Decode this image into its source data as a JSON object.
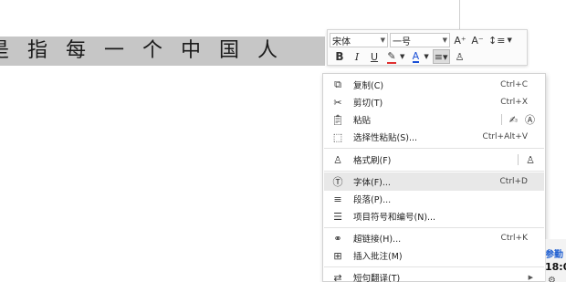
{
  "document": {
    "selected_text": "是指每一个中国人"
  },
  "mini_toolbar": {
    "font_name": "宋体",
    "font_size": "一号",
    "grow_font_icon": "A⁺",
    "shrink_font_icon": "A⁻",
    "bold": "B",
    "italic": "I",
    "underline": "U",
    "font_color_letter": "A"
  },
  "context_menu": {
    "items": [
      {
        "label": "复制(C)",
        "shortcut": "Ctrl+C",
        "icon": "copy-icon"
      },
      {
        "label": "剪切(T)",
        "shortcut": "Ctrl+X",
        "icon": "cut-icon"
      },
      {
        "label": "粘贴",
        "shortcut": "",
        "icon": "paste-icon"
      },
      {
        "label": "选择性粘贴(S)...",
        "shortcut": "Ctrl+Alt+V",
        "icon": "paste-special-icon"
      },
      {
        "label": "格式刷(F)",
        "shortcut": "",
        "icon": "format-painter-icon"
      },
      {
        "label": "字体(F)...",
        "shortcut": "Ctrl+D",
        "icon": "font-icon"
      },
      {
        "label": "段落(P)...",
        "shortcut": "",
        "icon": "paragraph-icon"
      },
      {
        "label": "项目符号和编号(N)...",
        "shortcut": "",
        "icon": "bullets-icon"
      },
      {
        "label": "超链接(H)...",
        "shortcut": "Ctrl+K",
        "icon": "hyperlink-icon"
      },
      {
        "label": "插入批注(M)",
        "shortcut": "",
        "icon": "comment-icon"
      },
      {
        "label": "短句翻译(T)",
        "shortcut": "",
        "icon": "translate-icon"
      }
    ]
  },
  "right_panel": {
    "label1": "参勤",
    "label2": "18:0"
  },
  "colors": {
    "selection": "#c6c6c6",
    "hover": "#e8e8e8",
    "font_color": "#1a4fd6",
    "highlight": "#e03030",
    "link_blue": "#1f5fd1"
  }
}
